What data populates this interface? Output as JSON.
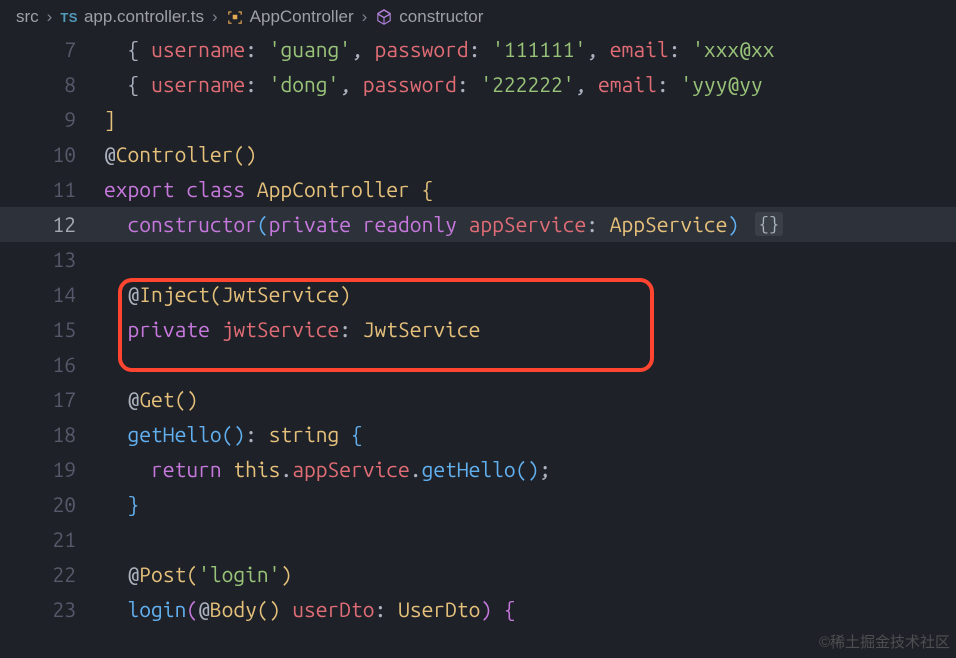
{
  "breadcrumbs": {
    "root": "src",
    "file": "app.controller.ts",
    "class": "AppController",
    "member": "constructor"
  },
  "lines": {
    "7": {},
    "8": {},
    "9": {},
    "10": {},
    "11": {},
    "12": {},
    "13": {},
    "14": {},
    "15": {},
    "16": {},
    "17": {},
    "18": {},
    "19": {},
    "20": {},
    "21": {},
    "22": {},
    "23": {}
  },
  "tok": {
    "brace_open": "{",
    "brace_close": "}",
    "bracket_open": "[",
    "bracket_close": "]",
    "paren_open": "(",
    "paren_close": ")",
    "comma": ",",
    "colon": ":",
    "semicolon": ";",
    "dot": ".",
    "at": "@",
    "space1": " ",
    "space2": "  ",
    "space3": "   ",
    "space4": "    "
  },
  "kw": {
    "export": "export",
    "class": "class",
    "constructor": "constructor",
    "private": "private",
    "readonly": "readonly",
    "return": "return",
    "string": "string",
    "this": "this"
  },
  "ident": {
    "username": "username",
    "password": "password",
    "email": "email",
    "AppController": "AppController",
    "appService": "appService",
    "AppService": "AppService",
    "Inject": "Inject",
    "JwtService": "JwtService",
    "jwtService": "jwtService",
    "Get": "Get",
    "Controller": "Controller",
    "getHello": "getHello",
    "Post": "Post",
    "login": "login",
    "Body": "Body",
    "userDto": "userDto",
    "UserDto": "UserDto"
  },
  "str": {
    "guang": "'guang'",
    "pw1": "'111111'",
    "xxx": "'xxx@xx",
    "dong": "'dong'",
    "pw2": "'222222'",
    "yyy": "'yyy@yy",
    "loginStr": "'login'"
  },
  "fold": {
    "ctor": "{}"
  },
  "watermark": "©稀土掘金技术社区"
}
